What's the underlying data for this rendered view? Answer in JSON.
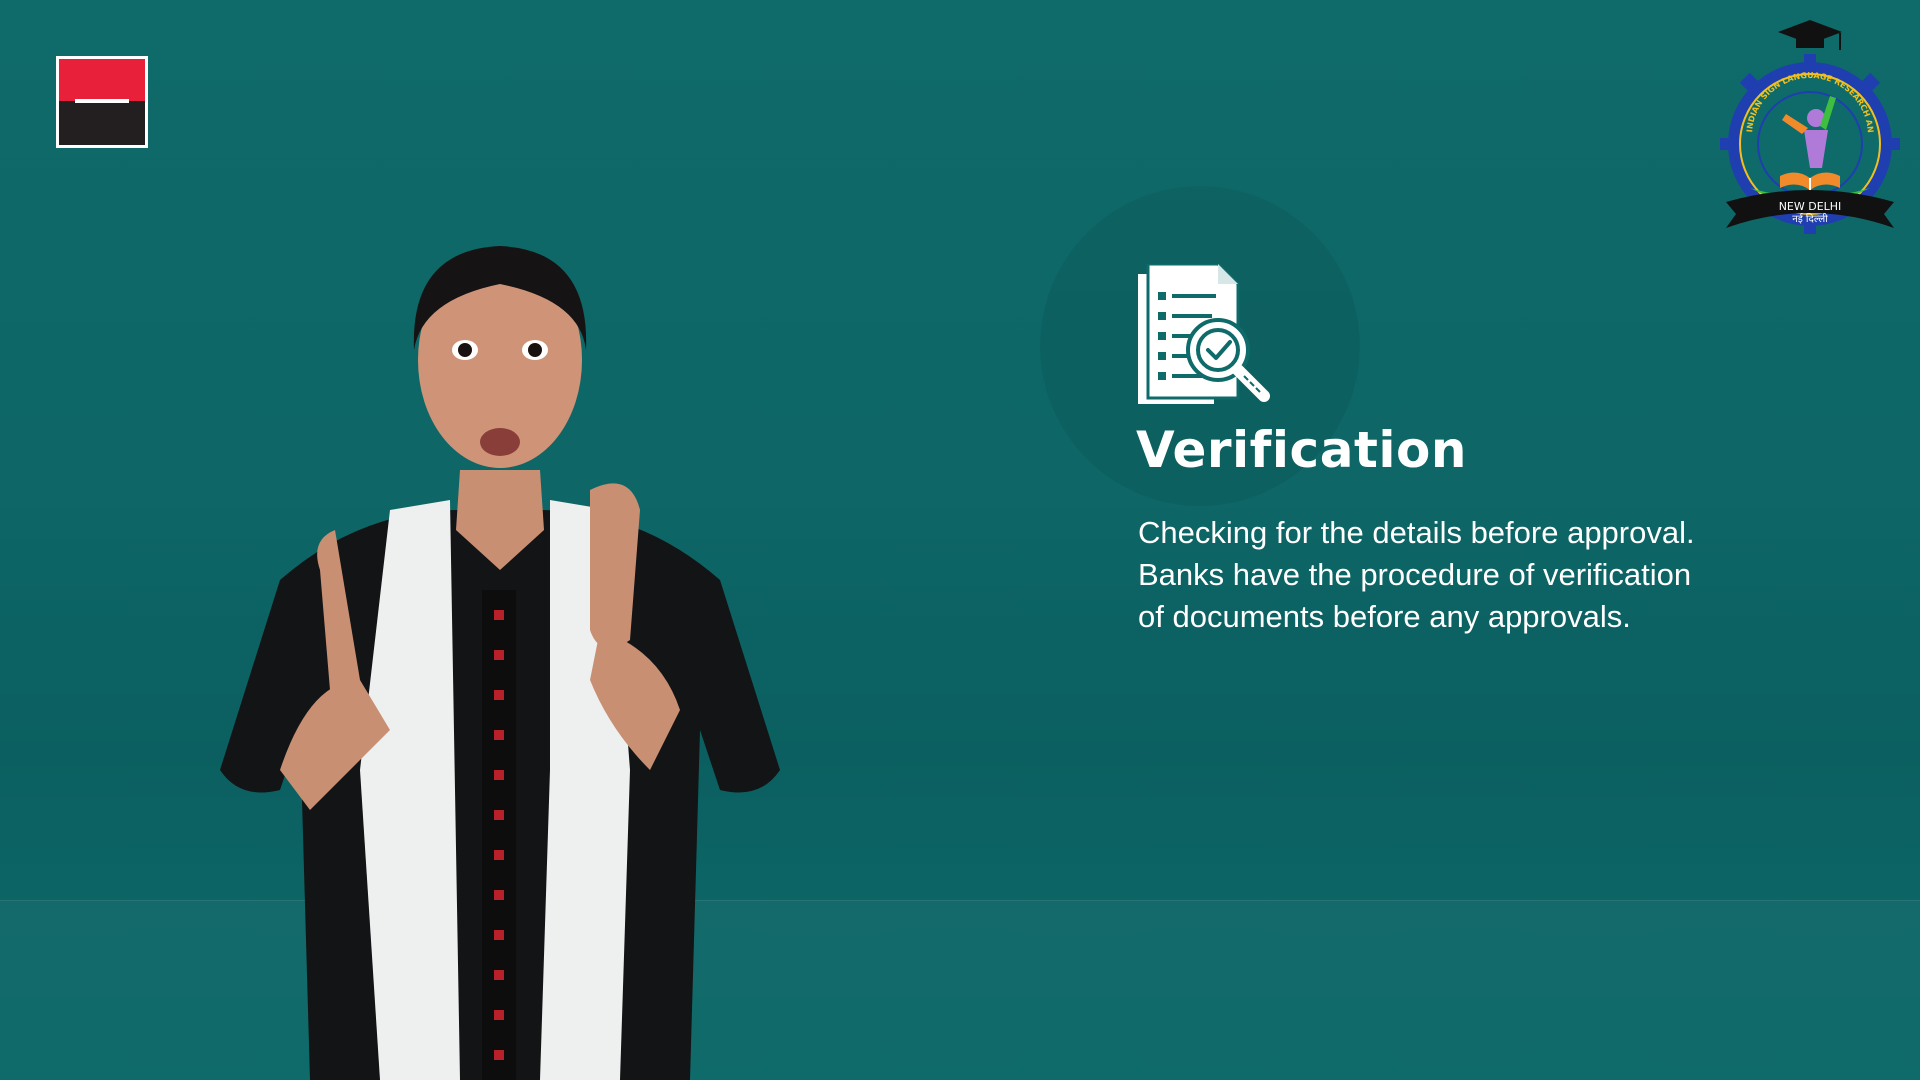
{
  "colors": {
    "background": "#0f6a6a",
    "heading": "#ffffff",
    "body_text": "#ffffff",
    "brand_red": "#e8203a",
    "brand_black": "#231f20"
  },
  "logos": {
    "left": {
      "icon": "red-black-square-logo"
    },
    "right": {
      "icon": "isl-training-centre-emblem",
      "arc_text": "INDIAN SIGN LANGUAGE RESEARCH AND TRAINING CENTRE",
      "banner_en": "NEW DELHI",
      "banner_hi": "नई दिल्ली"
    }
  },
  "signer": {
    "icon": "sign-language-interpreter"
  },
  "slide": {
    "icon": "document-verification-icon",
    "heading": "Verification",
    "lines": [
      "Checking for the details before approval.",
      "Banks have the procedure of verification",
      "of documents before any approvals."
    ]
  }
}
